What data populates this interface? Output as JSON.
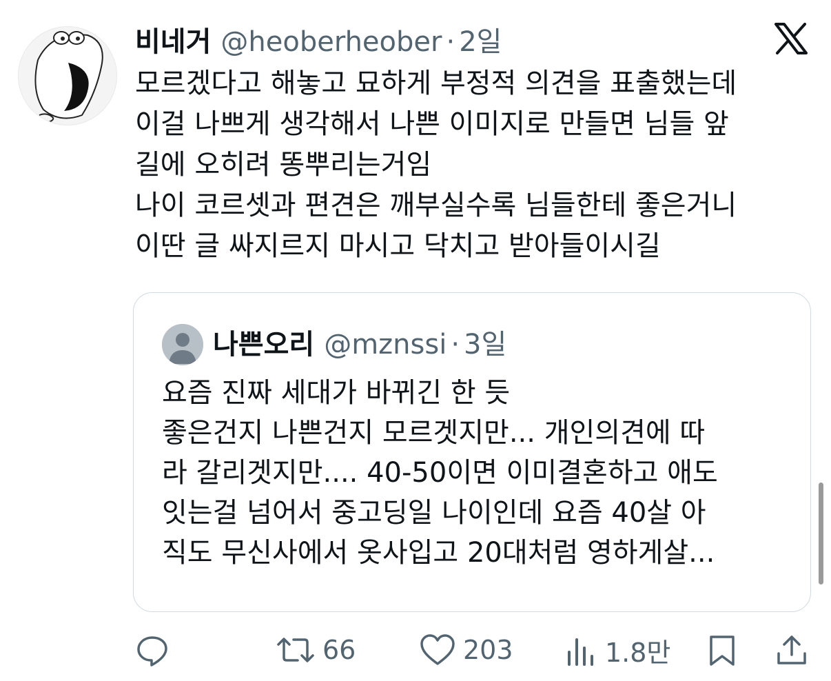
{
  "tweet": {
    "author_name": "비네거",
    "author_handle": "@heoberheober",
    "separator": "·",
    "time": "2일",
    "text": "모르겠다고 해놓고 묘하게 부정적 의견을 표출했는데\n이걸 나쁘게 생각해서 나쁜 이미지로 만들면 님들 앞\n길에 오히려 똥뿌리는거임\n나이 코르셋과 편견은 깨부실수록 님들한테 좋은거니\n이딴 글 싸지르지 마시고 닥치고 받아들이시길"
  },
  "quoted_tweet": {
    "author_name": "나쁜오리",
    "author_handle": "@mznssi",
    "separator": "·",
    "time": "3일",
    "text": "요즘 진짜 세대가 바뀌긴 한 듯\n좋은건지 나쁜건지 모르겟지만... 개인의견에 따\n라 갈리겟지만.... 40-50이면 이미결혼하고 애도\n잇는걸 넘어서 중고딩일 나이인데 요즘 40살 아\n직도 무신사에서 옷사입고 20대처럼 영하게살..."
  },
  "actions": {
    "reply_icon": "reply-icon",
    "retweet_icon": "retweet-icon",
    "retweets": "66",
    "like_icon": "heart-icon",
    "likes": "203",
    "views_icon": "views-icon",
    "views": "1.8만",
    "bookmark_icon": "bookmark-icon",
    "share_icon": "share-icon"
  },
  "colors": {
    "text_primary": "#0f1419",
    "text_secondary": "#536471",
    "border": "#cfd9de"
  }
}
